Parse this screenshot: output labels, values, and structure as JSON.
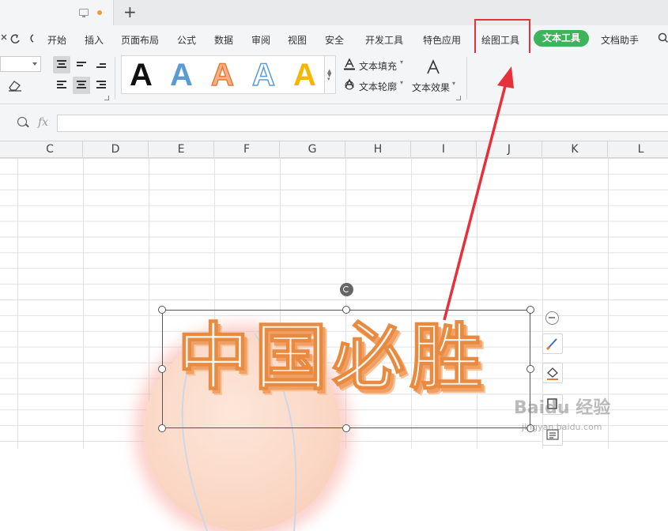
{
  "tab_bar": {
    "new_tab_label": "+"
  },
  "menu": {
    "items": [
      "开始",
      "插入",
      "页面布局",
      "公式",
      "数据",
      "审阅",
      "视图",
      "安全",
      "开发工具",
      "特色应用",
      "绘图工具",
      "文本工具",
      "文档助手"
    ],
    "highlighted_item": "绘图工具",
    "active_item": "文本工具",
    "active_color": "#3db45c",
    "highlight_color": "#e8303a"
  },
  "ribbon": {
    "styles_preview": [
      {
        "glyph": "A",
        "fill": "#111111",
        "outline": "none"
      },
      {
        "glyph": "A",
        "fill": "#5b9bd5",
        "outline": "none"
      },
      {
        "glyph": "A",
        "fill": "#f4b183",
        "outline": "#e8793a"
      },
      {
        "glyph": "A",
        "fill": "#ffffff",
        "outline": "#5b9bd5"
      },
      {
        "glyph": "A",
        "fill": "#f5b800",
        "outline": "none"
      }
    ],
    "text_fill_label": "文本填充",
    "text_outline_label": "文本轮廓",
    "text_effect_label": "文本效果"
  },
  "formula_bar": {
    "fx_label": "fx",
    "value": ""
  },
  "columns": [
    "C",
    "D",
    "E",
    "F",
    "G",
    "H",
    "I",
    "J",
    "K",
    "L"
  ],
  "canvas": {
    "wordart_text": "中国必胜",
    "wordart_color": "#e88a3f"
  },
  "side_tools": [
    "collapse-icon",
    "brush-icon",
    "fill-bucket-icon",
    "outline-icon",
    "text-wrap-icon"
  ],
  "watermark": {
    "brand": "Baidu 经验",
    "url": "jingyan.baidu.com"
  }
}
